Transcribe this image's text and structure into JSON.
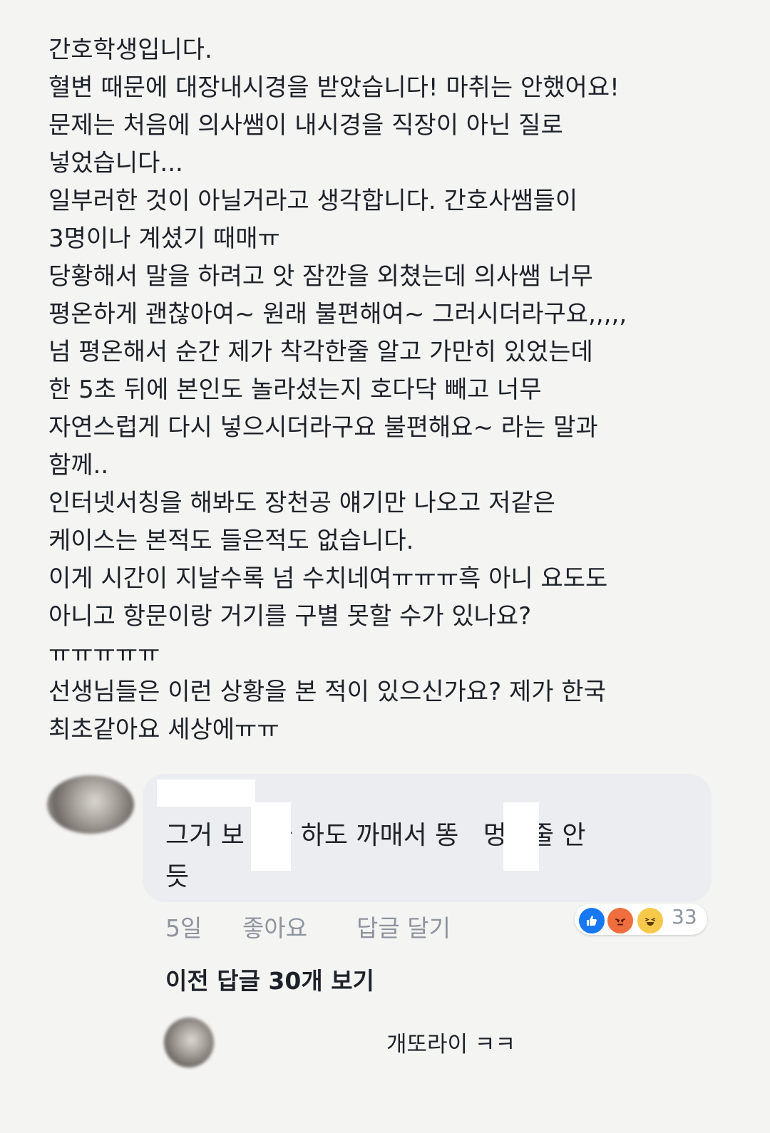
{
  "post": {
    "lines": [
      "간호학생입니다.",
      "혈변 때문에 대장내시경을 받았습니다! 마취는 안했어요!",
      "문제는 처음에 의사쌤이 내시경을 직장이 아닌 질로",
      "넣었습니다...",
      "일부러한 것이 아닐거라고 생각합니다. 간호사쌤들이",
      "3명이나 계셨기 때매ㅠ",
      "당황해서 말을 하려고 앗 잠깐을 외쳤는데 의사쌤 너무",
      "평온하게 괜찮아여~ 원래 불편해여~ 그러시더라구요,,,,,",
      "넘 평온해서 순간 제가 착각한줄 알고 가만히 있었는데",
      "한 5초 뒤에 본인도 놀라셨는지 호다닥 빼고 너무",
      "자연스럽게 다시 넣으시더라구요 불편해요~ 라는 말과",
      "함께..",
      "인터넷서칭을 해봐도 장천공 얘기만 나오고 저같은",
      "케이스는 본적도 들은적도 없습니다.",
      "이게 시간이 지날수록 넘 수치네여ㅠㅠㅠ흑 아니 요도도",
      "아니고 항문이랑 거기를 구별 못할 수가 있나요?",
      "ㅠㅠㅠㅠㅠ",
      "선생님들은 이런 상황을 본 적이 있으신가요? 제가 한국",
      "최초같아요 세상에ㅠㅠ"
    ]
  },
  "comment": {
    "text": "그거 보   가 하도 까매서 똥   멍인줄 안\n듯",
    "time": "5일",
    "like_label": "좋아요",
    "reply_label": "답글 달기",
    "reaction_count": "33",
    "reactions": [
      "like-icon",
      "angry-icon",
      "haha-icon"
    ]
  },
  "view_more": "이전 답글 30개 보기",
  "reply": {
    "text": "개또라이 ㅋㅋ"
  },
  "colors": {
    "background": "#f4f4f2",
    "bubble": "#ecedf0",
    "meta": "#8d949e",
    "like": "#1877f2",
    "angry": "#f06e3e",
    "haha": "#f7c94b"
  }
}
